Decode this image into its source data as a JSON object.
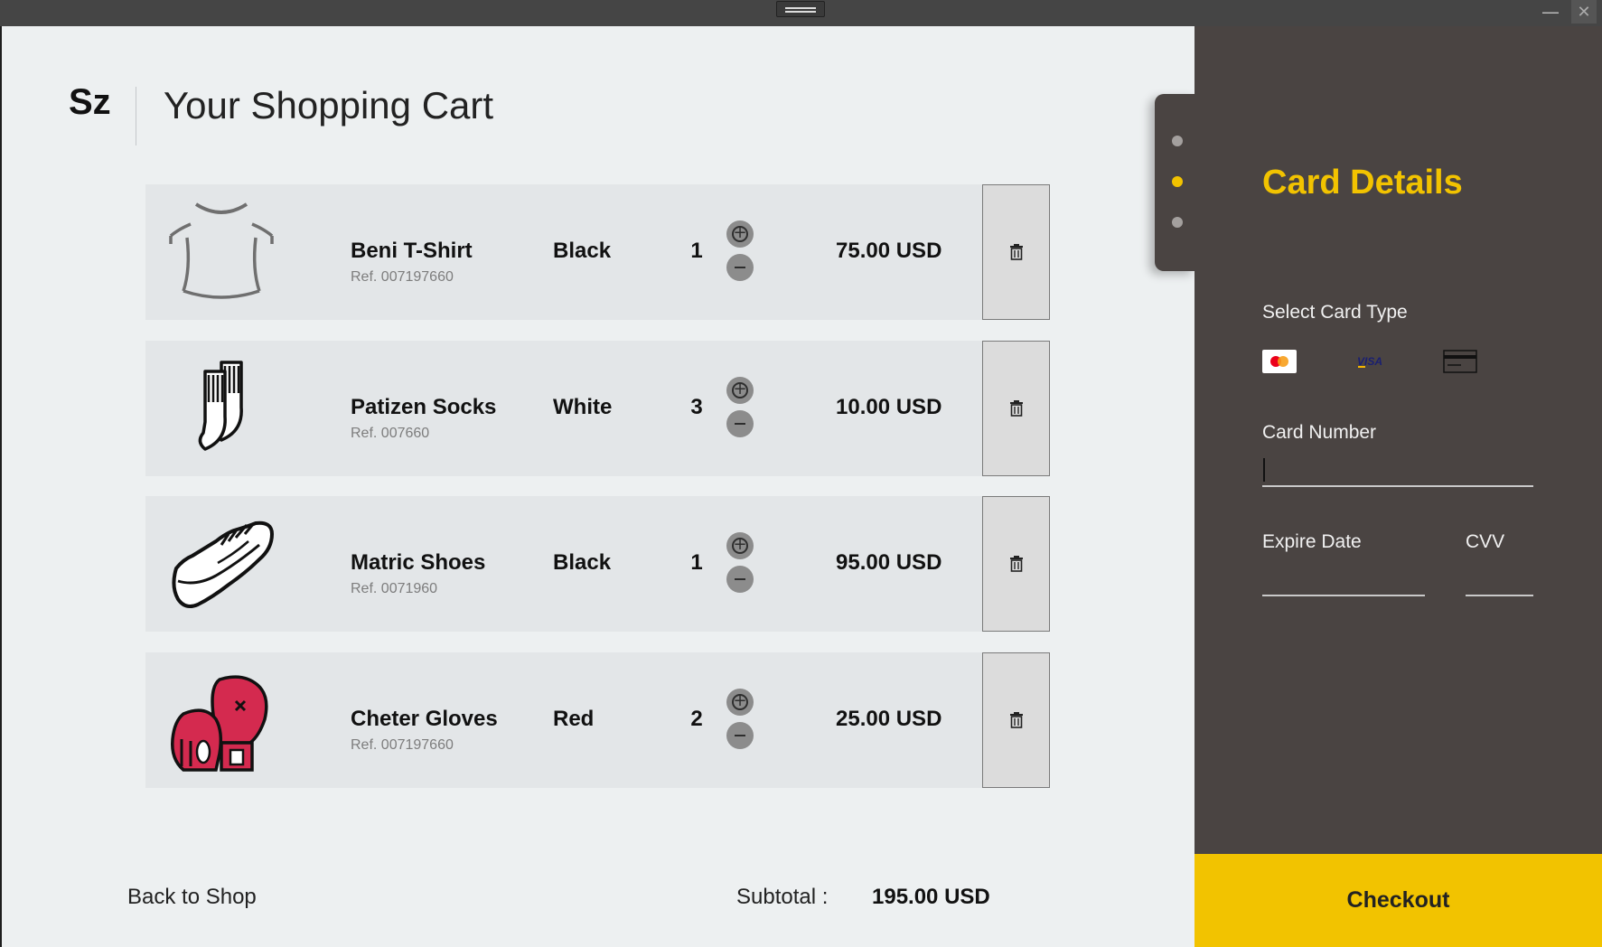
{
  "window": {
    "minimize_icon": "minimize-icon",
    "close_icon": "close-icon",
    "minimize_glyph": "—",
    "close_glyph": "✕"
  },
  "header": {
    "brand": "Sz",
    "title": "Your Shopping Cart"
  },
  "cart": {
    "items": [
      {
        "name": "Beni T-Shirt",
        "ref": "Ref. 007197660",
        "color": "Black",
        "quantity": "1",
        "price": "75.00 USD",
        "icon": "tshirt-icon"
      },
      {
        "name": "Patizen Socks",
        "ref": "Ref. 007660",
        "color": "White",
        "quantity": "3",
        "price": "10.00 USD",
        "icon": "socks-icon"
      },
      {
        "name": "Matric Shoes",
        "ref": "Ref. 0071960",
        "color": "Black",
        "quantity": "1",
        "price": "95.00 USD",
        "icon": "shoe-icon"
      },
      {
        "name": "Cheter Gloves",
        "ref": "Ref. 007197660",
        "color": "Red",
        "quantity": "2",
        "price": "25.00 USD",
        "icon": "boxing-gloves-icon"
      }
    ],
    "back_label": "Back to Shop",
    "subtotal_label": "Subtotal :",
    "subtotal_value": "195.00 USD"
  },
  "payment": {
    "steps": 3,
    "active_step": 2,
    "title": "Card Details",
    "select_card_label": "Select Card Type",
    "card_types": [
      "mastercard-icon",
      "visa-icon",
      "generic-card-icon"
    ],
    "card_number_label": "Card Number",
    "card_number_value": "",
    "expire_label": "Expire Date",
    "expire_value": "",
    "cvv_label": "CVV",
    "cvv_value": "",
    "checkout_label": "Checkout",
    "accent_color": "#f2c300"
  }
}
